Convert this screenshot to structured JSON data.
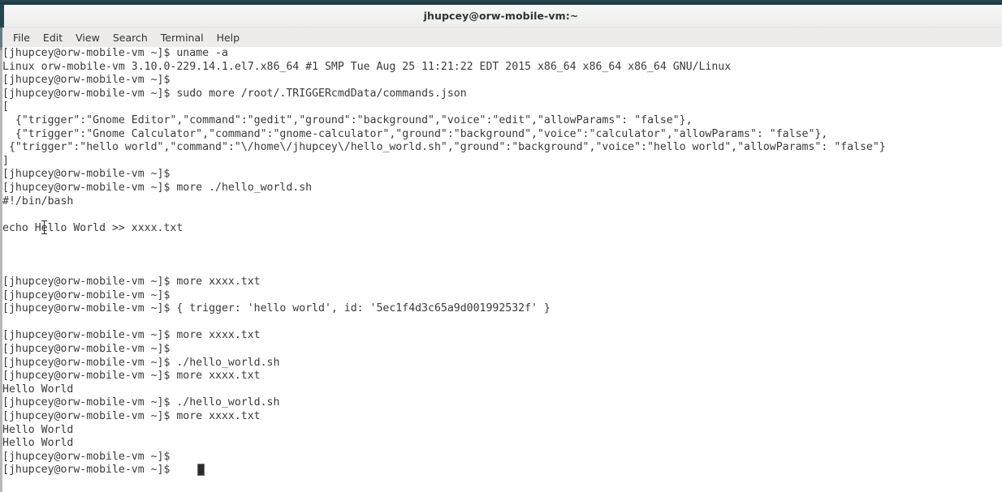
{
  "window": {
    "title": "jhupcey@orw-mobile-vm:~",
    "accent_color": "#24474f",
    "titlebar_bg": "#eeeeec",
    "menubar_bg": "#edecea",
    "terminal_bg": "#ffffff",
    "terminal_fg": "#3a3a3a"
  },
  "menubar": {
    "items": [
      {
        "label": "File"
      },
      {
        "label": "Edit"
      },
      {
        "label": "View"
      },
      {
        "label": "Search"
      },
      {
        "label": "Terminal"
      },
      {
        "label": "Help"
      }
    ]
  },
  "terminal": {
    "prompt": "[jhupcey@orw-mobile-vm ~]$",
    "cursor": {
      "shape": "block",
      "visible": true
    },
    "lines": [
      "[jhupcey@orw-mobile-vm ~]$ uname -a",
      "Linux orw-mobile-vm 3.10.0-229.14.1.el7.x86_64 #1 SMP Tue Aug 25 11:21:22 EDT 2015 x86_64 x86_64 x86_64 GNU/Linux",
      "[jhupcey@orw-mobile-vm ~]$",
      "[jhupcey@orw-mobile-vm ~]$ sudo more /root/.TRIGGERcmdData/commands.json",
      "[",
      "  {\"trigger\":\"Gnome Editor\",\"command\":\"gedit\",\"ground\":\"background\",\"voice\":\"edit\",\"allowParams\": \"false\"},",
      "  {\"trigger\":\"Gnome Calculator\",\"command\":\"gnome-calculator\",\"ground\":\"background\",\"voice\":\"calculator\",\"allowParams\": \"false\"},",
      " {\"trigger\":\"hello world\",\"command\":\"\\/home\\/jhupcey\\/hello_world.sh\",\"ground\":\"background\",\"voice\":\"hello world\",\"allowParams\": \"false\"}",
      "]",
      "[jhupcey@orw-mobile-vm ~]$",
      "[jhupcey@orw-mobile-vm ~]$ more ./hello_world.sh",
      "#!/bin/bash",
      "",
      "echo Hello World >> xxxx.txt",
      "",
      "",
      "",
      "[jhupcey@orw-mobile-vm ~]$ more xxxx.txt",
      "[jhupcey@orw-mobile-vm ~]$",
      "[jhupcey@orw-mobile-vm ~]$ { trigger: 'hello world', id: '5ec1f4d3c65a9d001992532f' }",
      "",
      "[jhupcey@orw-mobile-vm ~]$ more xxxx.txt",
      "[jhupcey@orw-mobile-vm ~]$",
      "[jhupcey@orw-mobile-vm ~]$ ./hello_world.sh",
      "[jhupcey@orw-mobile-vm ~]$ more xxxx.txt",
      "Hello World",
      "[jhupcey@orw-mobile-vm ~]$ ./hello_world.sh",
      "[jhupcey@orw-mobile-vm ~]$ more xxxx.txt",
      "Hello World",
      "Hello World",
      "[jhupcey@orw-mobile-vm ~]$",
      "[jhupcey@orw-mobile-vm ~]$"
    ]
  }
}
